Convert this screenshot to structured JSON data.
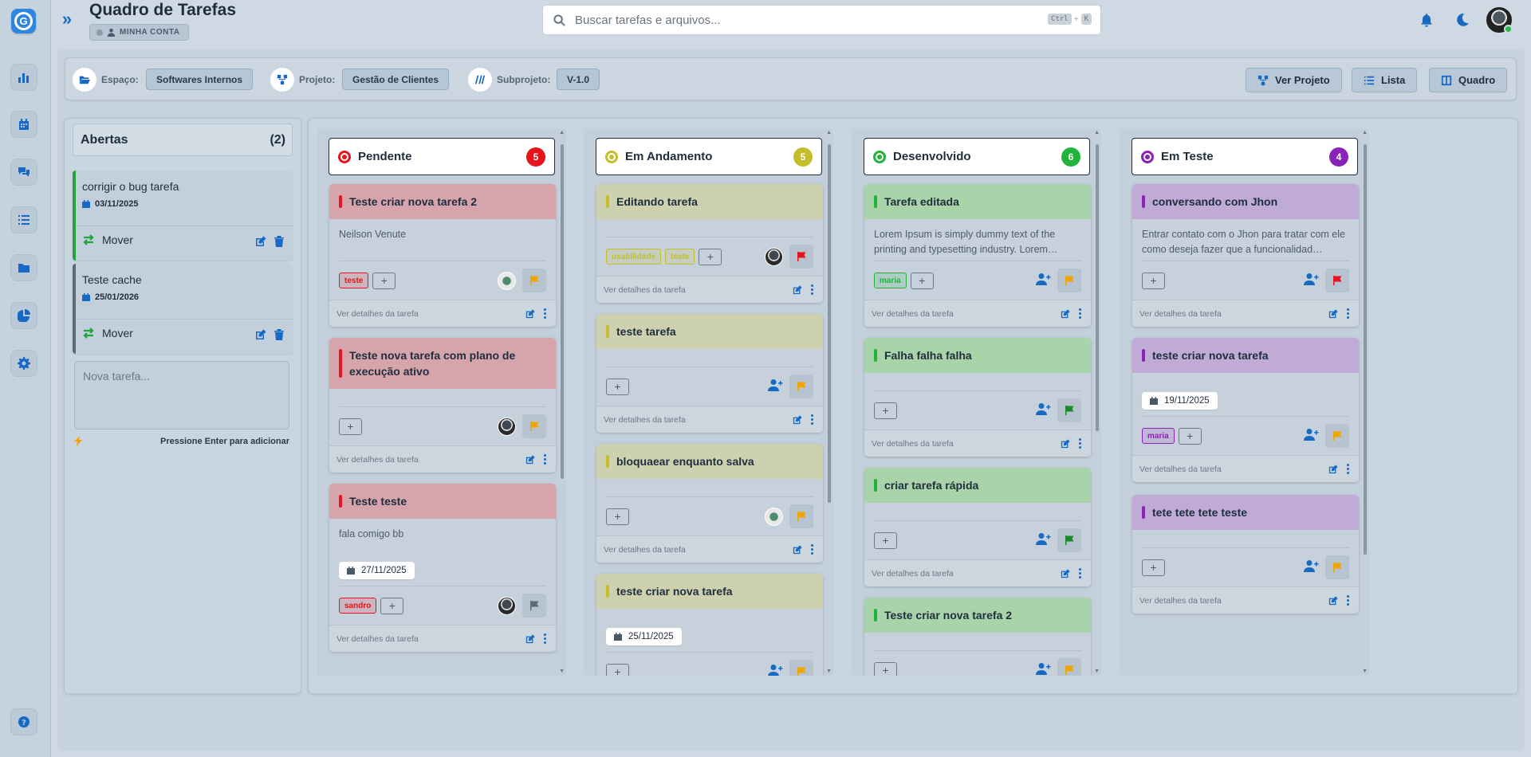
{
  "app": {
    "logo_letter": "G",
    "title": "Quadro de Tarefas",
    "account_label": "MINHA CONTA"
  },
  "search": {
    "placeholder": "Buscar tarefas e arquivos...",
    "shortcut_key1": "Ctrl",
    "shortcut_sep": "+",
    "shortcut_key2": "K"
  },
  "sidebar_icons": [
    "chart-icon",
    "calendar-icon",
    "chat-icon",
    "list-icon",
    "folder-icon",
    "pie-chart-icon",
    "gear-icon",
    "help-icon"
  ],
  "filters": {
    "space_label": "Espaço:",
    "space_value": "Softwares Internos",
    "project_label": "Projeto:",
    "project_value": "Gestão de Clientes",
    "subproject_label": "Subprojeto:",
    "subproject_value": "V-1.0"
  },
  "views": {
    "project": "Ver Projeto",
    "list": "Lista",
    "board": "Quadro"
  },
  "open_tasks": {
    "title": "Abertas",
    "count": "(2)",
    "items": [
      {
        "title": "corrigir o bug tarefa",
        "date": "03/11/2025",
        "move": "Mover",
        "bar_color": "#22a33b"
      },
      {
        "title": "Teste cache",
        "date": "25/01/2026",
        "move": "Mover",
        "bar_color": "#5d6a76"
      }
    ],
    "new_task_placeholder": "Nova tarefa...",
    "enter_hint": "Pressione Enter para adicionar"
  },
  "columns": [
    {
      "name": "Pendente",
      "count": "5",
      "color": "#e8141c",
      "header_bg": "#d6a4ab",
      "cards": [
        {
          "title": "Teste criar nova tarefa 2",
          "desc": "Neilson Venute",
          "tags": [
            {
              "label": "teste"
            }
          ],
          "avatar": "alt",
          "flag": "#f0a400",
          "details": "Ver detalhes da tarefa"
        },
        {
          "title": "Teste nova tarefa com plano de execução ativo",
          "desc": "",
          "tags": [],
          "avatar": "dark",
          "flag": "#f0a400",
          "details": "Ver detalhes da tarefa"
        },
        {
          "title": "Teste teste",
          "desc": "fala comigo bb",
          "date": "27/11/2025",
          "tags": [
            {
              "label": "sandro"
            }
          ],
          "avatar": "dark",
          "flag": "#5d6a76",
          "details": "Ver detalhes da tarefa"
        }
      ]
    },
    {
      "name": "Em Andamento",
      "count": "5",
      "color": "#c4be2a",
      "header_bg": "#cdd1b0",
      "cards": [
        {
          "title": "Editando tarefa",
          "desc": "",
          "tags": [
            {
              "label": "usabilidade"
            },
            {
              "label": "teste"
            }
          ],
          "avatar": "dark",
          "flag": "#e8141c",
          "details": "Ver detalhes da tarefa"
        },
        {
          "title": "teste tarefa",
          "desc": "",
          "tags": [],
          "avatar": "add",
          "flag": "#f0a400",
          "details": "Ver detalhes da tarefa"
        },
        {
          "title": "bloquaear enquanto salva",
          "desc": "",
          "tags": [],
          "avatar": "alt",
          "flag": "#f0a400",
          "details": "Ver detalhes da tarefa"
        },
        {
          "title": "teste criar nova tarefa",
          "desc": "",
          "date": "25/11/2025",
          "tags": [],
          "avatar": "add",
          "flag": "#f0a400",
          "details": "Ver detalhes da tarefa"
        }
      ]
    },
    {
      "name": "Desenvolvido",
      "count": "6",
      "color": "#22b33b",
      "header_bg": "#a9d3a9",
      "cards": [
        {
          "title": "Tarefa editada",
          "desc": "Lorem Ipsum is simply dummy text of the printing and typesetting industry. Lorem…",
          "tags": [
            {
              "label": "maria"
            }
          ],
          "avatar": "add",
          "flag": "#f0a400",
          "details": "Ver detalhes da tarefa"
        },
        {
          "title": "Falha falha falha",
          "desc": "",
          "tags": [],
          "avatar": "add",
          "flag": "#1a8a2a",
          "details": "Ver detalhes da tarefa"
        },
        {
          "title": "criar tarefa rápida",
          "desc": "",
          "tags": [],
          "avatar": "add",
          "flag": "#1a8a2a",
          "details": "Ver detalhes da tarefa"
        },
        {
          "title": "Teste criar nova tarefa 2",
          "desc": "",
          "tags": [],
          "avatar": "add",
          "flag": "#f0a400",
          "details": "Ver detalhes da tarefa"
        }
      ]
    },
    {
      "name": "Em Teste",
      "count": "4",
      "color": "#8a22b8",
      "header_bg": "#bfabd6",
      "cards": [
        {
          "title": "conversando com Jhon",
          "desc": "Entrar contato com o Jhon para tratar com ele como deseja fazer que a funcionalidad…",
          "tags": [],
          "avatar": "add",
          "flag": "#e8141c",
          "details": "Ver detalhes da tarefa"
        },
        {
          "title": "teste criar nova tarefa",
          "desc": "",
          "date": "19/11/2025",
          "tags": [
            {
              "label": "maria"
            }
          ],
          "avatar": "add",
          "flag": "#f0a400",
          "details": "Ver detalhes da tarefa"
        },
        {
          "title": "tete tete tete teste",
          "desc": "",
          "tags": [],
          "avatar": "add",
          "flag": "#f0a400",
          "details": "Ver detalhes da tarefa"
        }
      ]
    }
  ]
}
